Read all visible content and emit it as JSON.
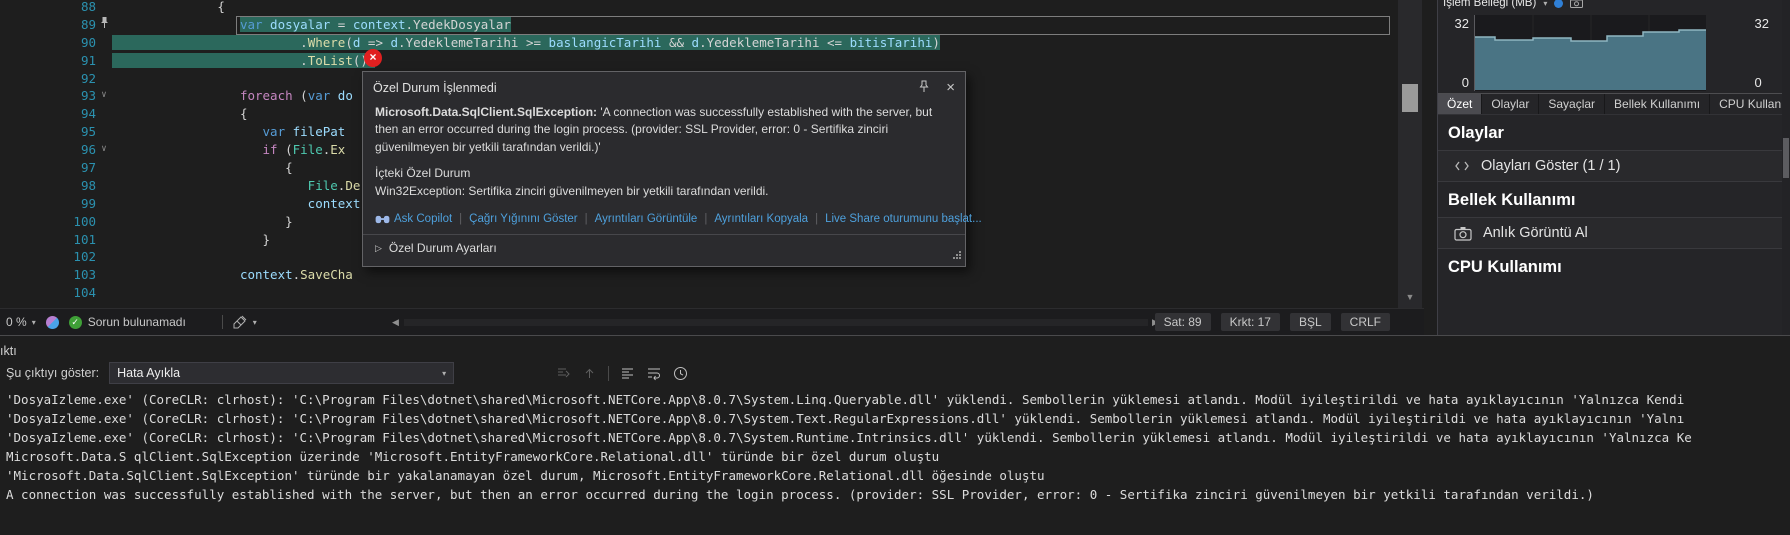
{
  "icons": {
    "close": "×",
    "caret_down": "▾",
    "fold": "∨",
    "settings_expander": "▷",
    "scroll_left": "◀",
    "scroll_right": "▶",
    "scroll_down": "▼",
    "separator": "|"
  },
  "colors": {
    "selection": "#2b685c",
    "error_badge": "#e02020",
    "link": "#4ea0dc",
    "chart_fill": "#4a7484",
    "line_number": "#2b91af"
  },
  "editor": {
    "lines": [
      {
        "num": "88",
        "ind": 14,
        "tok": [
          {
            "t": "{",
            "c": "p"
          }
        ]
      },
      {
        "num": "89",
        "ind": 17,
        "sel": "code",
        "box": 1,
        "pin": 1,
        "tok": [
          {
            "t": "var",
            "c": "k"
          },
          {
            "t": " ",
            "c": "p"
          },
          {
            "t": "dosyalar",
            "c": "v"
          },
          {
            "t": " = ",
            "c": "p"
          },
          {
            "t": "context",
            "c": "v"
          },
          {
            "t": ".YedekDosyalar",
            "c": "p"
          }
        ]
      },
      {
        "num": "90",
        "ind": 25,
        "sel": "line",
        "tok": [
          {
            "t": ".",
            "c": "p"
          },
          {
            "t": "Where",
            "c": "m"
          },
          {
            "t": "(",
            "c": "p"
          },
          {
            "t": "d",
            "c": "v"
          },
          {
            "t": " => ",
            "c": "p"
          },
          {
            "t": "d",
            "c": "v"
          },
          {
            "t": ".YedeklemeTarihi >= ",
            "c": "p"
          },
          {
            "t": "baslangicTarihi",
            "c": "v"
          },
          {
            "t": " && ",
            "c": "p"
          },
          {
            "t": "d",
            "c": "v"
          },
          {
            "t": ".YedeklemeTarihi <= ",
            "c": "p"
          },
          {
            "t": "bitisTarihi",
            "c": "v"
          },
          {
            "t": ")",
            "c": "p"
          }
        ]
      },
      {
        "num": "91",
        "ind": 25,
        "sel": "line",
        "tok": [
          {
            "t": ".",
            "c": "p"
          },
          {
            "t": "ToList",
            "c": "m"
          },
          {
            "t": "();",
            "c": "p"
          }
        ]
      },
      {
        "num": "92",
        "ind": 0,
        "tok": []
      },
      {
        "num": "93",
        "ind": 17,
        "fold": 1,
        "tok": [
          {
            "t": "foreach",
            "c": "c"
          },
          {
            "t": " (",
            "c": "p"
          },
          {
            "t": "var",
            "c": "k"
          },
          {
            "t": " ",
            "c": "p"
          },
          {
            "t": "do",
            "c": "v"
          }
        ]
      },
      {
        "num": "94",
        "ind": 17,
        "tok": [
          {
            "t": "{",
            "c": "p"
          }
        ]
      },
      {
        "num": "95",
        "ind": 20,
        "tok": [
          {
            "t": "var",
            "c": "k"
          },
          {
            "t": " ",
            "c": "p"
          },
          {
            "t": "filePat",
            "c": "v"
          }
        ]
      },
      {
        "num": "96",
        "ind": 20,
        "fold": 1,
        "tok": [
          {
            "t": "if",
            "c": "c"
          },
          {
            "t": " (",
            "c": "p"
          },
          {
            "t": "File",
            "c": "t"
          },
          {
            "t": ".",
            "c": "p"
          },
          {
            "t": "Ex",
            "c": "m"
          }
        ]
      },
      {
        "num": "97",
        "ind": 23,
        "tok": [
          {
            "t": "{",
            "c": "p"
          }
        ]
      },
      {
        "num": "98",
        "ind": 26,
        "tok": [
          {
            "t": "File",
            "c": "t"
          },
          {
            "t": ".",
            "c": "p"
          },
          {
            "t": "De",
            "c": "m"
          }
        ]
      },
      {
        "num": "99",
        "ind": 26,
        "tok": [
          {
            "t": "context",
            "c": "v"
          }
        ]
      },
      {
        "num": "100",
        "ind": 23,
        "tok": [
          {
            "t": "}",
            "c": "p"
          }
        ]
      },
      {
        "num": "101",
        "ind": 20,
        "tok": [
          {
            "t": "}",
            "c": "p"
          }
        ]
      },
      {
        "num": "102",
        "ind": 0,
        "tok": []
      },
      {
        "num": "103",
        "ind": 17,
        "tok": [
          {
            "t": "context",
            "c": "v"
          },
          {
            "t": ".",
            "c": "p"
          },
          {
            "t": "SaveCha",
            "c": "m"
          }
        ]
      },
      {
        "num": "104",
        "ind": 0,
        "tok": []
      }
    ],
    "status_bar": {
      "zoom": "0 %",
      "no_issues": "Sorun bulunamadı",
      "line": "Sat: 89",
      "column": "Krkt: 17",
      "spaces": "BŞL",
      "line_ending": "CRLF"
    }
  },
  "exception_popup": {
    "title": "Özel Durum İşlenmedi",
    "exception_type": "Microsoft.Data.SqlClient.SqlException:",
    "message": "'A connection was successfully established with the server, but then an error occurred during the login process. (provider: SSL Provider, error: 0 - Sertifika zinciri güvenilmeyen bir yetkili tarafından verildi.)'",
    "inner_header": "İçteki Özel Durum",
    "inner_message": "Win32Exception: Sertifika zinciri güvenilmeyen bir yetkili tarafından verildi.",
    "links": [
      "Ask Copilot",
      "Çağrı Yığınını Göster",
      "Ayrıntıları Görüntüle",
      "Ayrıntıları Kopyala",
      "Live Share oturumunu başlat..."
    ],
    "settings_label": "Özel Durum Ayarları"
  },
  "diagnostics": {
    "chart": {
      "title": "İşlem Belleği (MB)",
      "y_max": "32",
      "y_min": "0",
      "right_y_max": "32",
      "right_y_min": "0"
    },
    "tabs": [
      "Özet",
      "Olaylar",
      "Sayaçlar",
      "Bellek Kullanımı",
      "CPU Kullanımı"
    ],
    "active_tab": "Özet",
    "sections": [
      {
        "heading": "Olaylar",
        "item": "Olayları Göster (1 / 1)"
      },
      {
        "heading": "Bellek Kullanımı",
        "item": "Anlık Görüntü Al"
      },
      {
        "heading": "CPU Kullanımı"
      }
    ]
  },
  "output": {
    "title": "Çıktı",
    "show_label": "Şu çıktıyı göster:",
    "selected_filter": "Hata Ayıkla",
    "lines": [
      "'DosyaIzleme.exe' (CoreCLR: clrhost): 'C:\\Program Files\\dotnet\\shared\\Microsoft.NETCore.App\\8.0.7\\System.Linq.Queryable.dll' yüklendi. Sembollerin yüklemesi atlandı. Modül iyileştirildi ve hata ayıklayıcının 'Yalnızca Kendi",
      "'DosyaIzleme.exe' (CoreCLR: clrhost): 'C:\\Program Files\\dotnet\\shared\\Microsoft.NETCore.App\\8.0.7\\System.Text.RegularExpressions.dll' yüklendi. Sembollerin yüklemesi atlandı. Modül iyileştirildi ve hata ayıklayıcının 'Yalnı",
      "'DosyaIzleme.exe' (CoreCLR: clrhost): 'C:\\Program Files\\dotnet\\shared\\Microsoft.NETCore.App\\8.0.7\\System.Runtime.Intrinsics.dll' yüklendi. Sembollerin yüklemesi atlandı. Modül iyileştirildi ve hata ayıklayıcının 'Yalnızca Ke",
      "Microsoft.Data.S qlClient.SqlException üzerinde 'Microsoft.EntityFrameworkCore.Relational.dll' türünde bir özel durum oluştu",
      "'Microsoft.Data.SqlClient.SqlException' türünde bir yakalanamayan özel durum, Microsoft.EntityFrameworkCore.Relational.dll öğesinde oluştu",
      "A connection was successfully established with the server, but then an error occurred during the login process. (provider: SSL Provider, error: 0 - Sertifika zinciri güvenilmeyen bir yetkili tarafından verildi.)"
    ]
  }
}
